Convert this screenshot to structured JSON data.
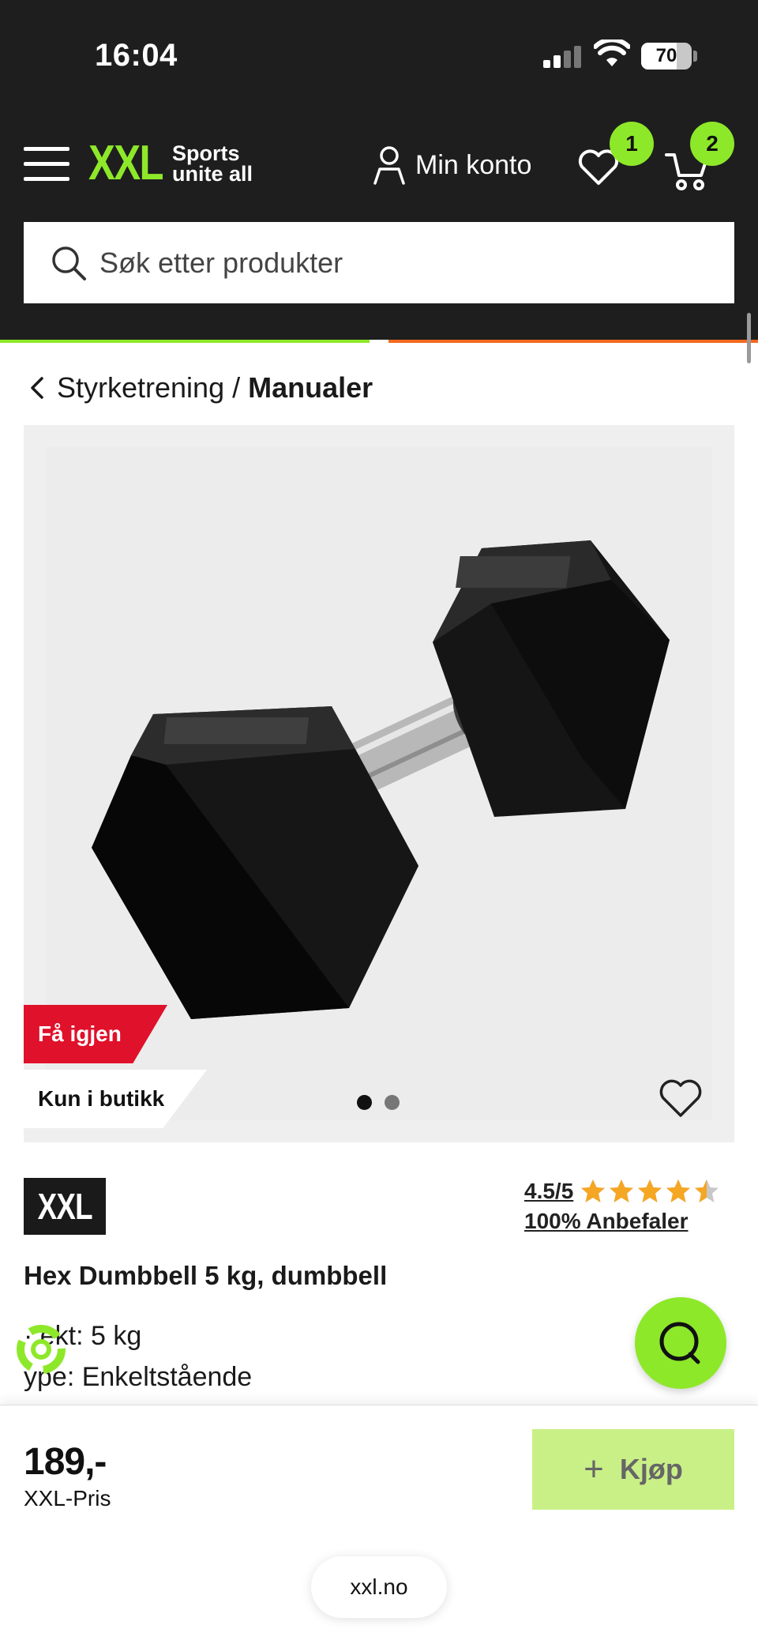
{
  "status_bar": {
    "time": "16:04",
    "battery_percent": "70",
    "battery_level": 0.7
  },
  "header": {
    "logo_text": "XXL",
    "logo_tagline": "Sports unite all",
    "account_label": "Min konto",
    "wishlist_count": "1",
    "cart_count": "2"
  },
  "search": {
    "placeholder": "Søk etter produkter"
  },
  "breadcrumb": {
    "parent": "Styrketrening",
    "separator": "/",
    "current": "Manualer"
  },
  "product": {
    "badges": [
      "Få igjen",
      "Kun i butikk"
    ],
    "image_count": 2,
    "active_image": 1,
    "brand": "XXL",
    "rating_text": "4.5/5",
    "rating_value": 4.5,
    "rating_max": 5,
    "recommend_text": "100% Anbefaler",
    "title": "Hex Dumbbell 5 kg, dumbbell",
    "attributes": [
      "Vekt: 5 kg",
      "Type: Enkeltstående"
    ],
    "attribute_visible": [
      "· ekt: 5 kg",
      "ype: Enkeltstående"
    ]
  },
  "purchase": {
    "price": "189,-",
    "price_label": "XXL-Pris",
    "buy_label": "Kjøp"
  },
  "browser": {
    "url": "xxl.no"
  },
  "colors": {
    "brand_green": "#8ee82a",
    "header_dark": "#1e1e1e",
    "badge_red": "#e0112b",
    "accent_orange": "#f26a21",
    "buy_button_disabled": "#c9f087",
    "star": "#f5a623"
  },
  "icons": {
    "menu": "hamburger-icon",
    "account": "user-icon",
    "wishlist": "heart-icon",
    "cart": "cart-icon",
    "search": "search-icon",
    "back": "chevron-left-icon",
    "favorite": "heart-outline-icon",
    "chat": "chat-icon",
    "eco": "recycle-icon",
    "buy": "plus-icon"
  }
}
